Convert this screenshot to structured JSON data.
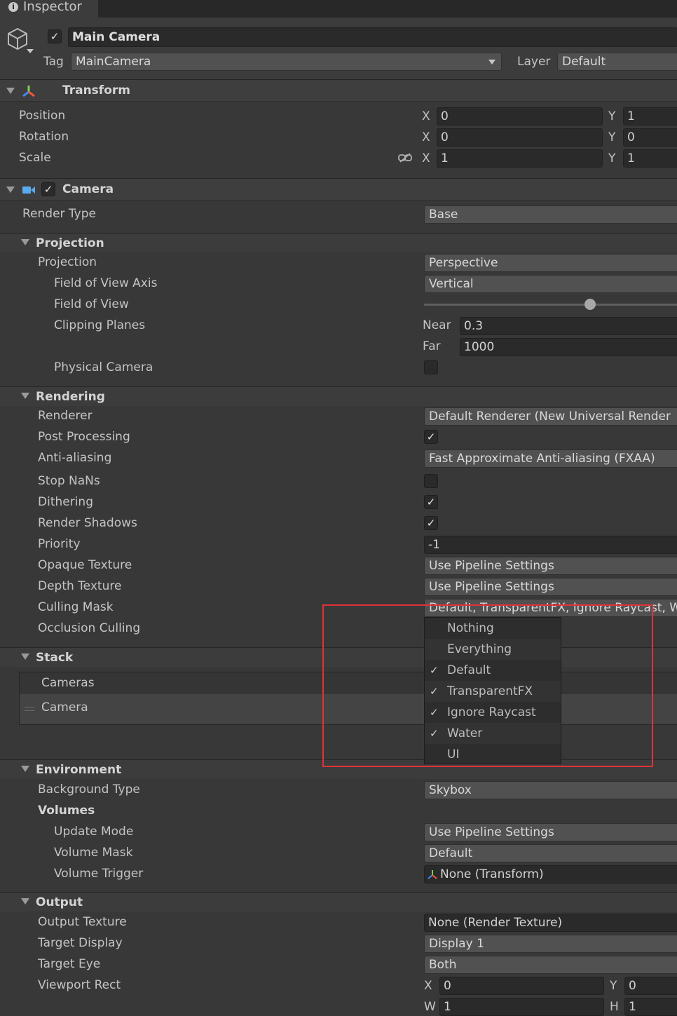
{
  "tab": {
    "title": "Inspector"
  },
  "object": {
    "name": "Main Camera",
    "enabled": true,
    "tag_label": "Tag",
    "tag_value": "MainCamera",
    "layer_label": "Layer",
    "layer_value": "Default"
  },
  "transform": {
    "title": "Transform",
    "position": {
      "label": "Position",
      "x_label": "X",
      "x": "0",
      "y_label": "Y",
      "y": "1"
    },
    "rotation": {
      "label": "Rotation",
      "x_label": "X",
      "x": "0",
      "y_label": "Y",
      "y": "0"
    },
    "scale": {
      "label": "Scale",
      "x_label": "X",
      "x": "1",
      "y_label": "Y",
      "y": "1"
    }
  },
  "camera": {
    "title": "Camera",
    "enabled": true,
    "render_type": {
      "label": "Render Type",
      "value": "Base"
    },
    "projection": {
      "title": "Projection",
      "projection": {
        "label": "Projection",
        "value": "Perspective"
      },
      "fov_axis": {
        "label": "Field of View Axis",
        "value": "Vertical"
      },
      "fov": {
        "label": "Field of View",
        "slider_fraction": 0.6
      },
      "clipping": {
        "label": "Clipping Planes",
        "near_label": "Near",
        "near": "0.3",
        "far_label": "Far",
        "far": "1000"
      },
      "physical": {
        "label": "Physical Camera",
        "checked": false
      }
    },
    "rendering": {
      "title": "Rendering",
      "renderer": {
        "label": "Renderer",
        "value": "Default Renderer (New Universal Render"
      },
      "post_processing": {
        "label": "Post Processing",
        "checked": true
      },
      "anti_aliasing": {
        "label": "Anti-aliasing",
        "value": "Fast Approximate Anti-aliasing (FXAA)"
      },
      "stop_nans": {
        "label": "Stop NaNs",
        "checked": false
      },
      "dithering": {
        "label": "Dithering",
        "checked": true
      },
      "render_shadows": {
        "label": "Render Shadows",
        "checked": true
      },
      "priority": {
        "label": "Priority",
        "value": "-1"
      },
      "opaque_texture": {
        "label": "Opaque Texture",
        "value": "Use Pipeline Settings"
      },
      "depth_texture": {
        "label": "Depth Texture",
        "value": "Use Pipeline Settings"
      },
      "culling_mask": {
        "label": "Culling Mask",
        "value": "Default, TransparentFX, Ignore Raycast, W"
      },
      "occlusion_culling": {
        "label": "Occlusion Culling"
      }
    },
    "stack": {
      "title": "Stack",
      "list_header": "Cameras",
      "item": "Camera"
    },
    "environment": {
      "title": "Environment",
      "background_type": {
        "label": "Background Type",
        "value": "Skybox"
      },
      "volumes": {
        "label": "Volumes"
      },
      "update_mode": {
        "label": "Update Mode",
        "value": "Use Pipeline Settings"
      },
      "volume_mask": {
        "label": "Volume Mask",
        "value": "Default"
      },
      "volume_trigger": {
        "label": "Volume Trigger",
        "value": "None (Transform)"
      }
    },
    "output": {
      "title": "Output",
      "output_texture": {
        "label": "Output Texture",
        "value": "None (Render Texture)"
      },
      "target_display": {
        "label": "Target Display",
        "value": "Display 1"
      },
      "target_eye": {
        "label": "Target Eye",
        "value": "Both"
      },
      "viewport": {
        "label": "Viewport Rect",
        "x_label": "X",
        "x": "0",
        "y_label": "Y",
        "y": "0",
        "w_label": "W",
        "w": "1",
        "h_label": "H",
        "h": "1"
      }
    }
  },
  "culling_menu": {
    "items": [
      {
        "label": "Nothing",
        "checked": false
      },
      {
        "label": "Everything",
        "checked": false
      },
      {
        "label": "Default",
        "checked": true
      },
      {
        "label": "TransparentFX",
        "checked": true
      },
      {
        "label": "Ignore Raycast",
        "checked": true
      },
      {
        "label": "Water",
        "checked": true
      },
      {
        "label": "UI",
        "checked": false
      }
    ],
    "check_glyph": "✓"
  },
  "colors": {
    "highlight_box": "#e0323a",
    "panel_bg": "#383838",
    "field_bg": "#2a2a2a"
  },
  "icons": {
    "info": "info-icon",
    "cube": "cube-icon",
    "transform": "transform-axes-icon",
    "camera": "camera-icon",
    "unlink": "unlink-icon"
  }
}
